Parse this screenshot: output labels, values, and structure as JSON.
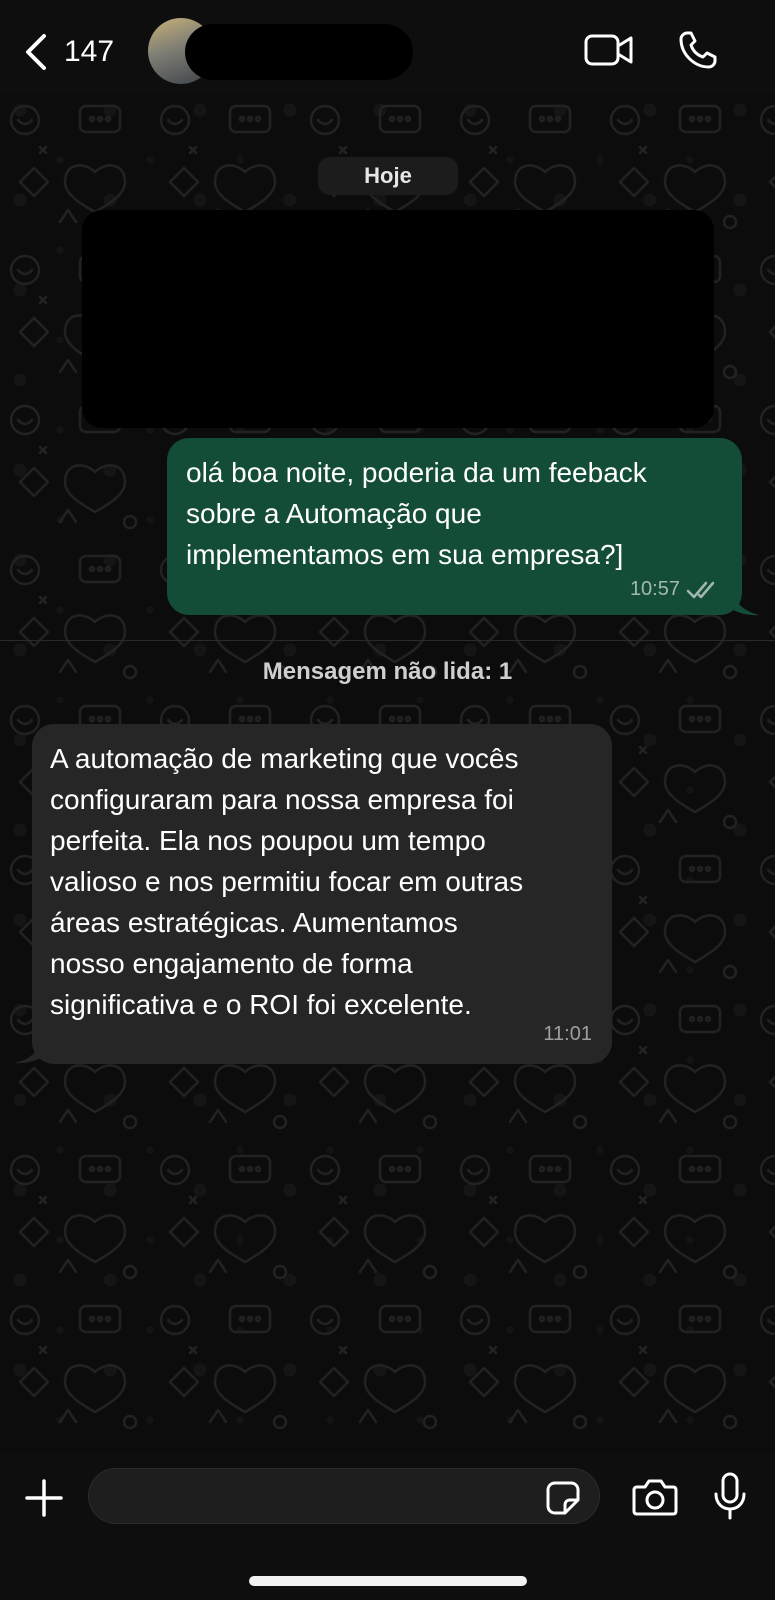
{
  "header": {
    "back_count": "147",
    "contact_name": "",
    "back_icon": "chevron-left-icon",
    "video_icon": "video-camera-icon",
    "phone_icon": "phone-icon"
  },
  "chat": {
    "date_label": "Hoje",
    "unread_banner": "Mensagem não lida: 1",
    "messages": [
      {
        "direction": "outgoing",
        "text": "olá boa noite, poderia da um  feeback\nsobre a Automação que\nimplementamos em sua empresa?]",
        "time": "10:57",
        "status": "delivered"
      },
      {
        "direction": "incoming",
        "text": "A automação de marketing que vocês\nconfiguraram para nossa empresa foi\nperfeita. Ela nos poupou um tempo\nvalioso e nos permitiu focar em outras\náreas estratégicas. Aumentamos\nnosso engajamento de forma\nsignificativa e o ROI foi excelente.",
        "time": "11:01"
      }
    ]
  },
  "composer": {
    "input_value": "",
    "plus_icon": "plus-icon",
    "sticker_icon": "sticker-icon",
    "camera_icon": "camera-icon",
    "mic_icon": "microphone-icon"
  },
  "colors": {
    "outgoing_bubble": "#144d37",
    "incoming_bubble": "#262626",
    "background": "#0c0c0c"
  }
}
